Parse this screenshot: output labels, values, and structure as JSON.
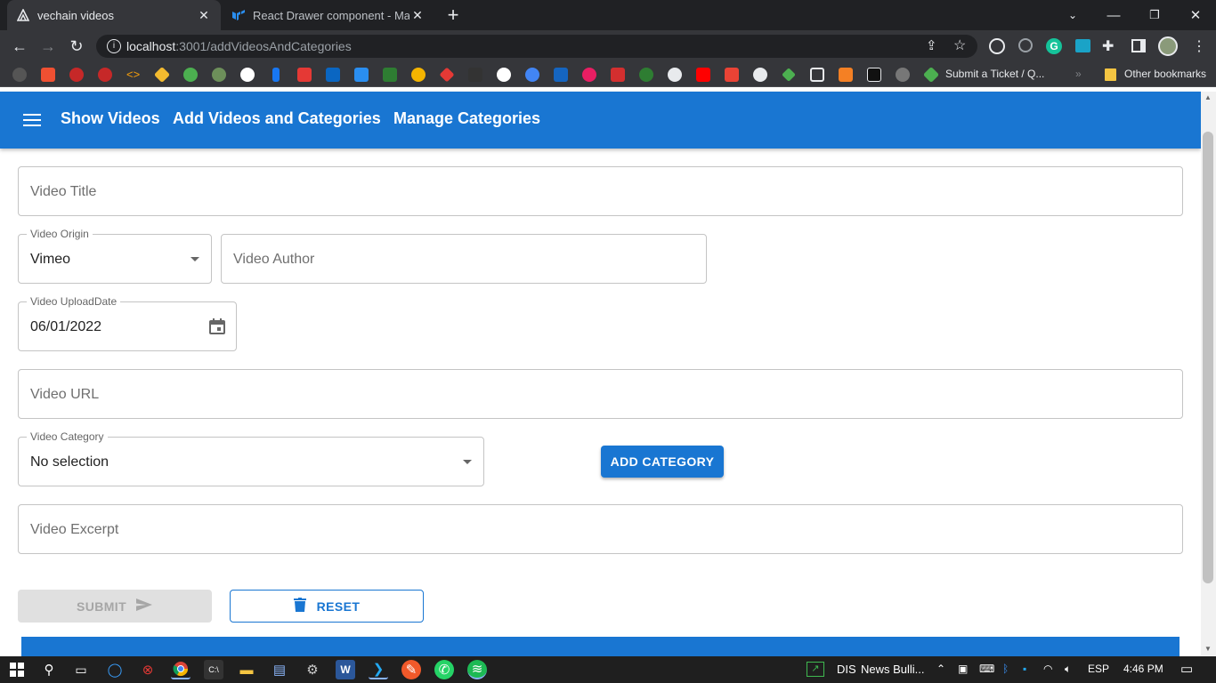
{
  "browser": {
    "tabs": [
      {
        "title": "vechain videos",
        "active": true
      },
      {
        "title": "React Drawer component - Mate",
        "active": false
      }
    ],
    "new_tab": "+",
    "address": {
      "host": "localhost",
      "path": ":3001/addVideosAndCategories"
    },
    "bookmark_ticket": "Submit a Ticket / Q...",
    "bookmark_overflow": "»",
    "bookmark_other": "Other bookmarks"
  },
  "appbar": {
    "menu_icon": "menu-icon",
    "links": [
      "Show Videos",
      "Add Videos and Categories",
      "Manage Categories"
    ]
  },
  "form": {
    "video_title": {
      "placeholder": "Video Title"
    },
    "video_origin": {
      "label": "Video Origin",
      "value": "Vimeo"
    },
    "video_author": {
      "placeholder": "Video Author"
    },
    "upload_date": {
      "label": "Video UploadDate",
      "value": "06/01/2022"
    },
    "video_url": {
      "placeholder": "Video URL"
    },
    "video_category": {
      "label": "Video Category",
      "value": "No selection"
    },
    "add_category": "ADD CATEGORY",
    "video_excerpt": {
      "placeholder": "Video Excerpt"
    },
    "submit": "SUBMIT",
    "reset": "RESET"
  },
  "taskbar": {
    "stock_label": "DIS",
    "news": "News Bulli...",
    "lang": "ESP",
    "time": "4:46 PM"
  },
  "colors": {
    "primary": "#1976d2",
    "chrome_dark": "#202124",
    "chrome_bar": "#35363a"
  }
}
